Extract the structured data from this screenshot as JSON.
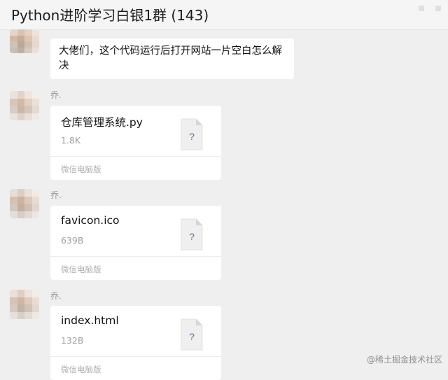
{
  "header": {
    "title": "Python进阶学习白银1群 (143)"
  },
  "messages": [
    {
      "type": "text",
      "text": "大佬们，这个代码运行后打开网站一片空白怎么解决"
    },
    {
      "type": "file",
      "nickname": "乔.",
      "file_name": "仓库管理系统.py",
      "file_size": "1.8K",
      "source": "微信电脑版",
      "icon": "unknown-file-icon",
      "icon_mark": "?"
    },
    {
      "type": "file",
      "nickname": "乔.",
      "file_name": "favicon.ico",
      "file_size": "639B",
      "source": "微信电脑版",
      "icon": "unknown-file-icon",
      "icon_mark": "?"
    },
    {
      "type": "file",
      "nickname": "乔.",
      "file_name": "index.html",
      "file_size": "132B",
      "source": "微信电脑版",
      "icon": "unknown-file-icon",
      "icon_mark": "?"
    }
  ],
  "watermark": "@稀土掘金技术社区",
  "colors": {
    "chat_bg": "#efefef",
    "bubble_bg": "#ffffff",
    "icon_mark": "#6a6aa8"
  }
}
